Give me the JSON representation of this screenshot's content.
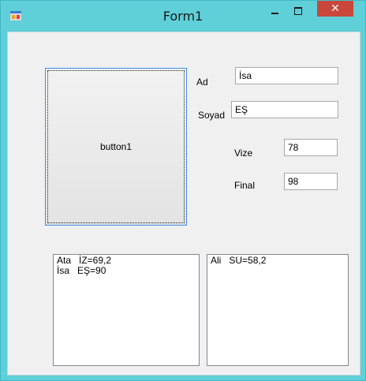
{
  "window": {
    "title": "Form1",
    "close_glyph": "✕",
    "icons": [
      "app-icon",
      "minimize-icon",
      "maximize-icon",
      "close-icon"
    ],
    "titlebar_color": "#5fcfd8",
    "close_color": "#c9483b"
  },
  "form": {
    "button1_label": "button1",
    "ad_label": "Ad",
    "ad_value": "İsa",
    "soyad_label": "Soyad",
    "soyad_value": "EŞ",
    "vize_label": "Vize",
    "vize_value": "78",
    "final_label": "Final",
    "final_value": "98"
  },
  "lists": {
    "left_items": [
      "Ata   İZ=69,2",
      "İsa   EŞ=90"
    ],
    "right_items": [
      "Ali   SU=58,2"
    ]
  }
}
